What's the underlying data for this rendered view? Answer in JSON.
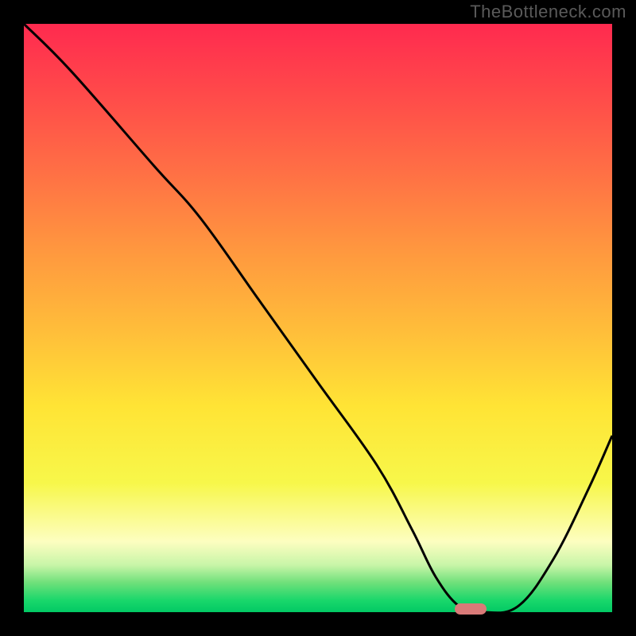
{
  "watermark": "TheBottleneck.com",
  "chart_data": {
    "type": "line",
    "title": "",
    "xlabel": "",
    "ylabel": "",
    "xlim": [
      0,
      100
    ],
    "ylim": [
      0,
      100
    ],
    "series": [
      {
        "name": "curve",
        "x": [
          0,
          8,
          22,
          30,
          40,
          50,
          60,
          66,
          70,
          74,
          78,
          84,
          90,
          96,
          100
        ],
        "y": [
          100,
          92,
          76,
          67,
          53,
          39,
          25,
          14,
          6,
          1,
          0,
          1,
          9,
          21,
          30
        ]
      }
    ],
    "marker": {
      "x": 76,
      "y": 0.5,
      "color": "#d97a78"
    },
    "gradient_stops": [
      {
        "pct": 0,
        "color": "#ff2a4f"
      },
      {
        "pct": 25,
        "color": "#ff6f45"
      },
      {
        "pct": 52,
        "color": "#ffbd3a"
      },
      {
        "pct": 78,
        "color": "#f7f74a"
      },
      {
        "pct": 95,
        "color": "#6fe07a"
      },
      {
        "pct": 100,
        "color": "#02c964"
      }
    ]
  }
}
